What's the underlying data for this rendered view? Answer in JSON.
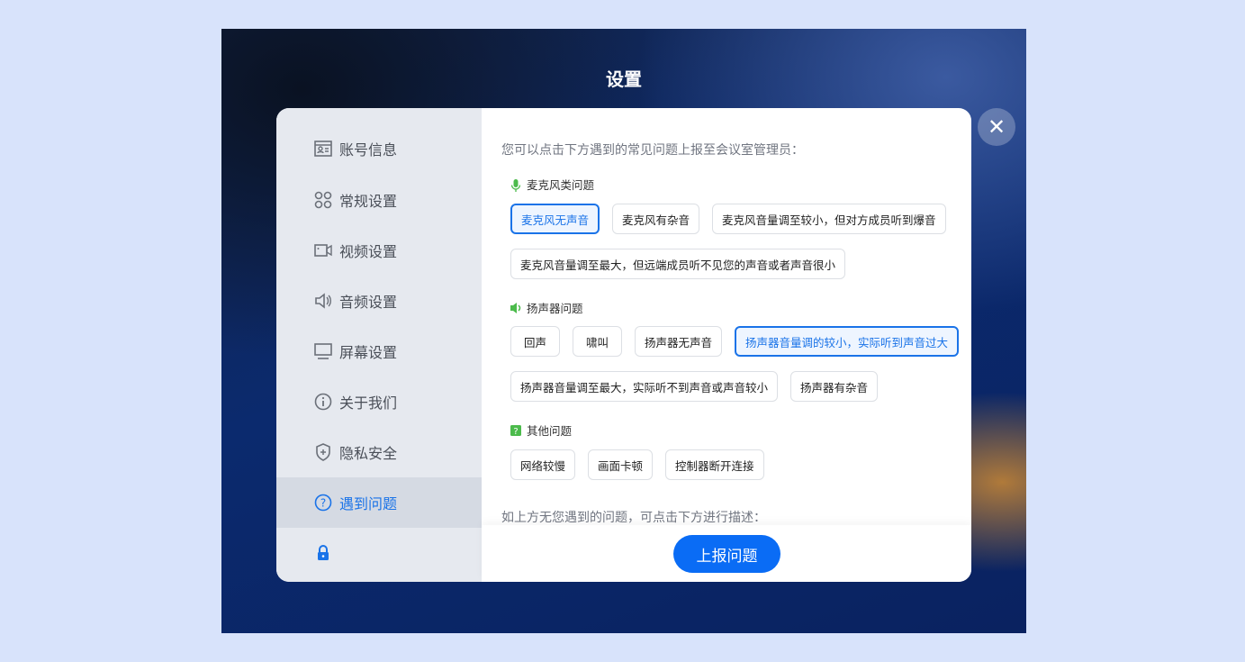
{
  "title": "设置",
  "sidebar": {
    "items": [
      {
        "label": "账号信息",
        "icon": "id-card-icon"
      },
      {
        "label": "常规设置",
        "icon": "grid-circles-icon"
      },
      {
        "label": "视频设置",
        "icon": "video-camera-icon"
      },
      {
        "label": "音频设置",
        "icon": "speaker-icon"
      },
      {
        "label": "屏幕设置",
        "icon": "monitor-icon"
      },
      {
        "label": "关于我们",
        "icon": "info-icon"
      },
      {
        "label": "隐私安全",
        "icon": "shield-icon"
      },
      {
        "label": "遇到问题",
        "icon": "question-icon",
        "selected": true
      }
    ],
    "lock_icon": "lock-icon"
  },
  "main": {
    "intro": "您可以点击下方遇到的常见问题上报至会议室管理员：",
    "sections": [
      {
        "label": "麦克风类问题",
        "icon": "microphone-icon",
        "chips": [
          {
            "label": "麦克风无声音",
            "selected": true
          },
          {
            "label": "麦克风有杂音"
          },
          {
            "label": "麦克风音量调至较小，但对方成员听到爆音"
          },
          {
            "label": "麦克风音量调至最大，但远端成员听不见您的声音或者声音很小"
          }
        ]
      },
      {
        "label": "扬声器问题",
        "icon": "speaker-icon",
        "chips": [
          {
            "label": "回声"
          },
          {
            "label": "啸叫"
          },
          {
            "label": "扬声器无声音"
          },
          {
            "label": "扬声器音量调的较小，实际听到声音过大",
            "selected": true
          },
          {
            "label": "扬声器音量调至最大，实际听不到声音或声音较小"
          },
          {
            "label": "扬声器有杂音"
          }
        ]
      },
      {
        "label": "其他问题",
        "icon": "question-box-icon",
        "chips": [
          {
            "label": "网络较慢"
          },
          {
            "label": "画面卡顿"
          },
          {
            "label": "控制器断开连接"
          }
        ]
      }
    ],
    "bottom_text": "如上方无您遇到的问题，可点击下方进行描述：",
    "report_button": "上报问题"
  },
  "colors": {
    "accent": "#0a6cf5",
    "section_icon": "#4cbb4c"
  }
}
